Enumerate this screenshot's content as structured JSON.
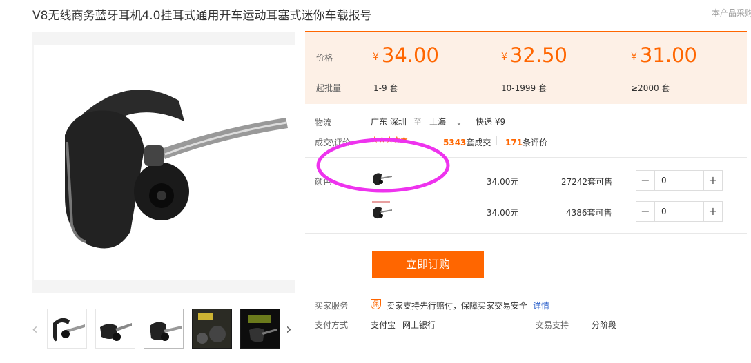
{
  "title": "V8无线商务蓝牙耳机4.0挂耳式通用开车运动耳塞式迷你车载报号",
  "corner_note": "本产品采购",
  "price_panel": {
    "price_label": "价格",
    "moq_label": "起批量",
    "currency": "¥",
    "tiers": [
      {
        "price": "34.00",
        "range": "1-9 套"
      },
      {
        "price": "32.50",
        "range": "10-1999 套"
      },
      {
        "price": "31.00",
        "range": "≥2000 套"
      }
    ]
  },
  "logistics": {
    "label": "物流",
    "from": "广东 深圳",
    "to_word": "至",
    "to": "上海",
    "shipping": "快递 ¥9"
  },
  "transactions": {
    "label": "成交\\评价",
    "rating": 4.5,
    "deals_count": "5343",
    "deals_suffix": "套成交",
    "reviews_count": "171",
    "reviews_suffix": "条评价"
  },
  "variants": {
    "label": "颜色",
    "rows": [
      {
        "price": "34.00元",
        "stock": "27242套可售",
        "qty": "0"
      },
      {
        "price": "34.00元",
        "stock": "4386套可售",
        "qty": "0"
      }
    ]
  },
  "stepper": {
    "minus": "−",
    "plus": "+"
  },
  "buy_button": "立即订购",
  "service": {
    "buyer_label": "买家服务",
    "guarantee_icon": "保",
    "guarantee_text": "卖家支持先行赔付，保障买家交易安全",
    "details_link": "详情",
    "payment_label": "支付方式",
    "payment_methods": [
      "支付宝",
      "网上银行"
    ],
    "trade_label": "交易支持",
    "trade_value": "分阶段"
  },
  "thumb_nav": {
    "prev": "‹",
    "next": "›"
  },
  "colors": {
    "accent": "#ff6600",
    "annotation": "#ee33ee",
    "price_bg": "#fdf0e6"
  }
}
